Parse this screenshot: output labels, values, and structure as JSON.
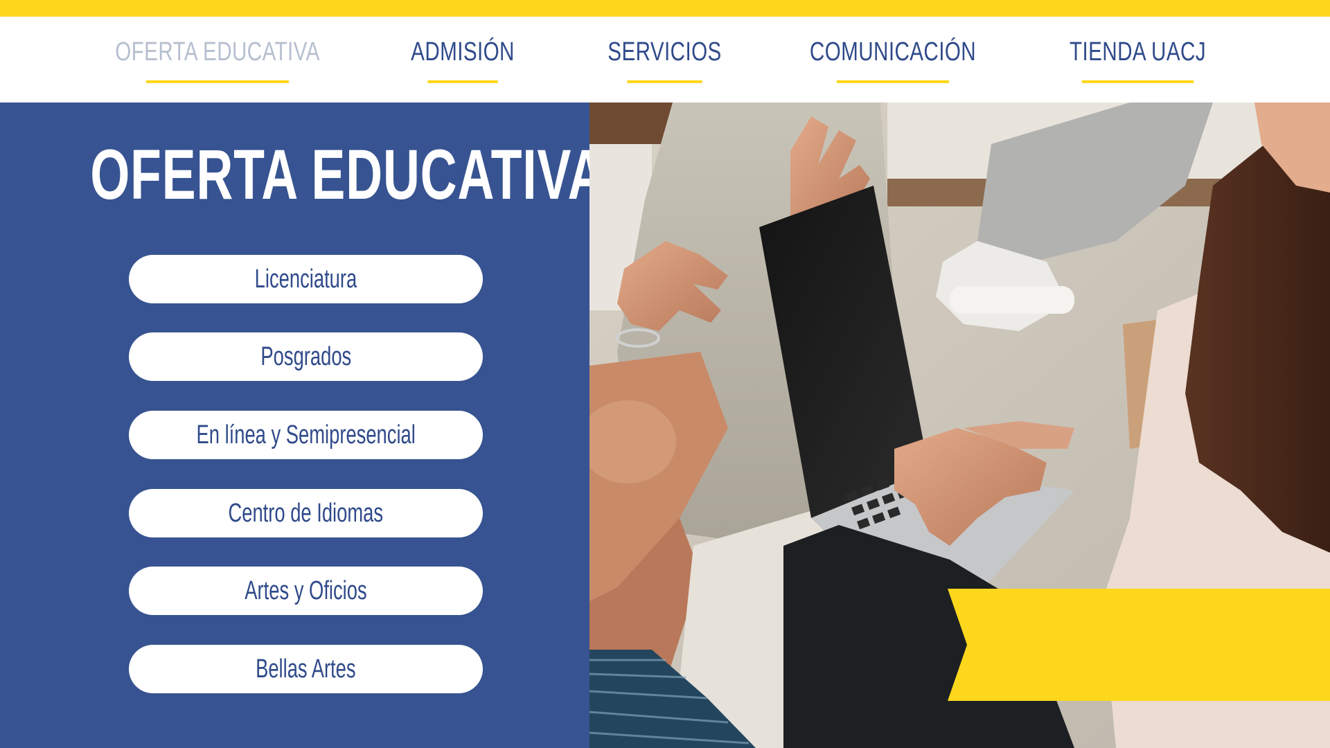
{
  "nav": {
    "items": [
      {
        "label": "OFERTA EDUCATIVA",
        "active": true
      },
      {
        "label": "ADMISIÓN",
        "active": false
      },
      {
        "label": "SERVICIOS",
        "active": false
      },
      {
        "label": "COMUNICACIÓN",
        "active": false
      },
      {
        "label": "TIENDA UACJ",
        "active": false
      }
    ]
  },
  "panel": {
    "title": "OFERTA EDUCATIVA",
    "buttons": [
      {
        "label": "Licenciatura"
      },
      {
        "label": "Posgrados"
      },
      {
        "label": "En línea y Semipresencial"
      },
      {
        "label": "Centro de Idiomas"
      },
      {
        "label": "Artes y Oficios"
      },
      {
        "label": "Bellas Artes"
      }
    ]
  },
  "colors": {
    "brand_blue": "#375391",
    "accent_yellow": "#fdd71c",
    "nav_text": "#2f4a8a",
    "nav_active_text": "#b6bfcf"
  }
}
